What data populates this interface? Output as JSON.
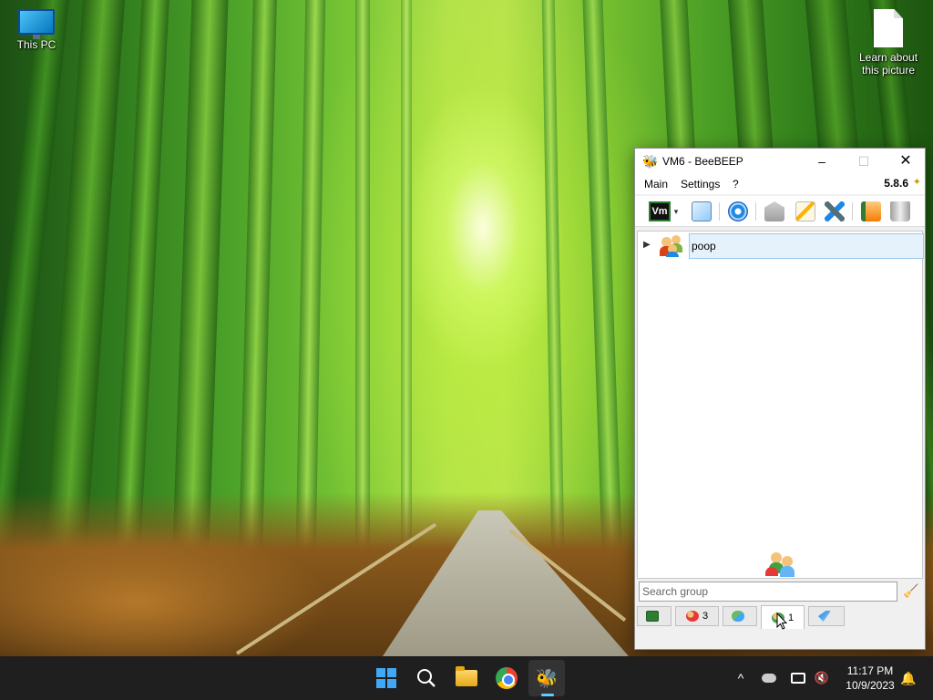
{
  "desktop": {
    "icons": [
      {
        "label": "This PC"
      },
      {
        "label": "Learn about this picture"
      }
    ]
  },
  "window": {
    "title": "VM6 - BeeBEEP",
    "controls": {
      "minimize": "–",
      "maximize": "☐",
      "close": "✕"
    },
    "menu": {
      "main": "Main",
      "settings": "Settings",
      "help": "?"
    },
    "version": "5.8.6",
    "toolbar": {
      "vm_label": "Vm",
      "dropdown": "▾"
    },
    "group_list": {
      "groups": [
        {
          "name": "poop",
          "expanded": false
        }
      ]
    },
    "search": {
      "placeholder": "Search group",
      "value": ""
    },
    "bottom_tabs": [
      {
        "name": "home",
        "count": ""
      },
      {
        "name": "users",
        "count": "3"
      },
      {
        "name": "chats",
        "count": ""
      },
      {
        "name": "groups",
        "count": "1",
        "active": true
      },
      {
        "name": "shares",
        "count": ""
      }
    ]
  },
  "taskbar": {
    "apps": [
      "Start",
      "Search",
      "File Explorer",
      "Google Chrome",
      "BeeBEEP"
    ],
    "active_app": "BeeBEEP",
    "tray": {
      "overflow": "^"
    },
    "clock": {
      "time": "11:17 PM",
      "date": "10/9/2023"
    }
  },
  "colors": {
    "taskbar_bg": "#1f1f1f",
    "selection_bg": "#e5f1fb",
    "selection_border": "#99c9ef",
    "win_accent": "#3fa9f5"
  }
}
